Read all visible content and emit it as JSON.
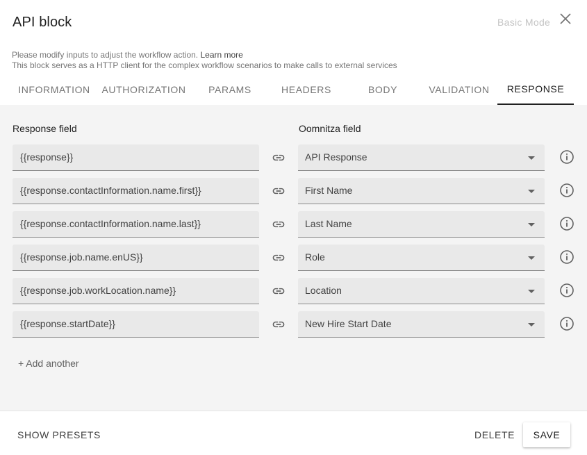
{
  "header": {
    "title": "API block",
    "mode_link": "Basic Mode",
    "description_line1": "Please modify inputs to adjust the workflow action.",
    "learn_more": "Learn more",
    "description_line2": "This block serves as a HTTP client for the complex workflow scenarios to make calls to external services"
  },
  "tabs": [
    {
      "label": "INFORMATION"
    },
    {
      "label": "AUTHORIZATION"
    },
    {
      "label": "PARAMS"
    },
    {
      "label": "HEADERS"
    },
    {
      "label": "BODY"
    },
    {
      "label": "VALIDATION"
    },
    {
      "label": "RESPONSE",
      "active": true
    }
  ],
  "mapping": {
    "response_label": "Response field",
    "oomnitza_label": "Oomnitza field",
    "rows": [
      {
        "response": "{{response}}",
        "field": "API Response"
      },
      {
        "response": "{{response.contactInformation.name.first}}",
        "field": "First Name"
      },
      {
        "response": "{{response.contactInformation.name.last}}",
        "field": "Last Name"
      },
      {
        "response": "{{response.job.name.enUS}}",
        "field": "Role"
      },
      {
        "response": "{{response.job.workLocation.name}}",
        "field": "Location"
      },
      {
        "response": "{{response.startDate}}",
        "field": "New Hire Start Date"
      }
    ],
    "add_another": "+ Add another"
  },
  "footer": {
    "show_presets": "SHOW PRESETS",
    "delete": "DELETE",
    "save": "SAVE"
  },
  "icons": {
    "close": "close-icon",
    "link": "link-icon",
    "info": "info-icon",
    "dropdown": "chevron-down-icon"
  },
  "colors": {
    "content_bg": "#f4f4f4",
    "field_bg": "#e9e9e9",
    "active_tab": "#212121",
    "muted_text": "#757575"
  }
}
